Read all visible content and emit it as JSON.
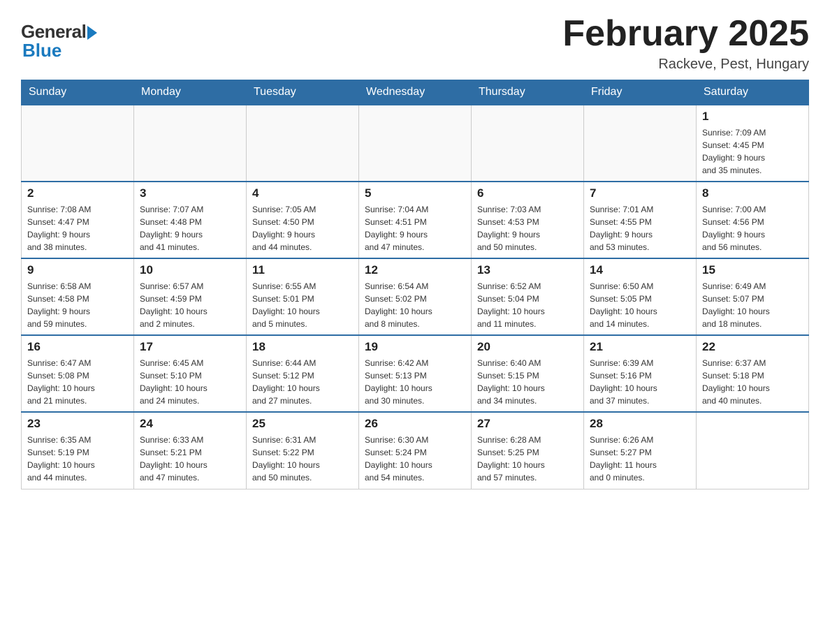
{
  "logo": {
    "general": "General",
    "blue": "Blue"
  },
  "header": {
    "month": "February 2025",
    "location": "Rackeve, Pest, Hungary"
  },
  "weekdays": [
    "Sunday",
    "Monday",
    "Tuesday",
    "Wednesday",
    "Thursday",
    "Friday",
    "Saturday"
  ],
  "weeks": [
    [
      {
        "day": "",
        "info": ""
      },
      {
        "day": "",
        "info": ""
      },
      {
        "day": "",
        "info": ""
      },
      {
        "day": "",
        "info": ""
      },
      {
        "day": "",
        "info": ""
      },
      {
        "day": "",
        "info": ""
      },
      {
        "day": "1",
        "info": "Sunrise: 7:09 AM\nSunset: 4:45 PM\nDaylight: 9 hours\nand 35 minutes."
      }
    ],
    [
      {
        "day": "2",
        "info": "Sunrise: 7:08 AM\nSunset: 4:47 PM\nDaylight: 9 hours\nand 38 minutes."
      },
      {
        "day": "3",
        "info": "Sunrise: 7:07 AM\nSunset: 4:48 PM\nDaylight: 9 hours\nand 41 minutes."
      },
      {
        "day": "4",
        "info": "Sunrise: 7:05 AM\nSunset: 4:50 PM\nDaylight: 9 hours\nand 44 minutes."
      },
      {
        "day": "5",
        "info": "Sunrise: 7:04 AM\nSunset: 4:51 PM\nDaylight: 9 hours\nand 47 minutes."
      },
      {
        "day": "6",
        "info": "Sunrise: 7:03 AM\nSunset: 4:53 PM\nDaylight: 9 hours\nand 50 minutes."
      },
      {
        "day": "7",
        "info": "Sunrise: 7:01 AM\nSunset: 4:55 PM\nDaylight: 9 hours\nand 53 minutes."
      },
      {
        "day": "8",
        "info": "Sunrise: 7:00 AM\nSunset: 4:56 PM\nDaylight: 9 hours\nand 56 minutes."
      }
    ],
    [
      {
        "day": "9",
        "info": "Sunrise: 6:58 AM\nSunset: 4:58 PM\nDaylight: 9 hours\nand 59 minutes."
      },
      {
        "day": "10",
        "info": "Sunrise: 6:57 AM\nSunset: 4:59 PM\nDaylight: 10 hours\nand 2 minutes."
      },
      {
        "day": "11",
        "info": "Sunrise: 6:55 AM\nSunset: 5:01 PM\nDaylight: 10 hours\nand 5 minutes."
      },
      {
        "day": "12",
        "info": "Sunrise: 6:54 AM\nSunset: 5:02 PM\nDaylight: 10 hours\nand 8 minutes."
      },
      {
        "day": "13",
        "info": "Sunrise: 6:52 AM\nSunset: 5:04 PM\nDaylight: 10 hours\nand 11 minutes."
      },
      {
        "day": "14",
        "info": "Sunrise: 6:50 AM\nSunset: 5:05 PM\nDaylight: 10 hours\nand 14 minutes."
      },
      {
        "day": "15",
        "info": "Sunrise: 6:49 AM\nSunset: 5:07 PM\nDaylight: 10 hours\nand 18 minutes."
      }
    ],
    [
      {
        "day": "16",
        "info": "Sunrise: 6:47 AM\nSunset: 5:08 PM\nDaylight: 10 hours\nand 21 minutes."
      },
      {
        "day": "17",
        "info": "Sunrise: 6:45 AM\nSunset: 5:10 PM\nDaylight: 10 hours\nand 24 minutes."
      },
      {
        "day": "18",
        "info": "Sunrise: 6:44 AM\nSunset: 5:12 PM\nDaylight: 10 hours\nand 27 minutes."
      },
      {
        "day": "19",
        "info": "Sunrise: 6:42 AM\nSunset: 5:13 PM\nDaylight: 10 hours\nand 30 minutes."
      },
      {
        "day": "20",
        "info": "Sunrise: 6:40 AM\nSunset: 5:15 PM\nDaylight: 10 hours\nand 34 minutes."
      },
      {
        "day": "21",
        "info": "Sunrise: 6:39 AM\nSunset: 5:16 PM\nDaylight: 10 hours\nand 37 minutes."
      },
      {
        "day": "22",
        "info": "Sunrise: 6:37 AM\nSunset: 5:18 PM\nDaylight: 10 hours\nand 40 minutes."
      }
    ],
    [
      {
        "day": "23",
        "info": "Sunrise: 6:35 AM\nSunset: 5:19 PM\nDaylight: 10 hours\nand 44 minutes."
      },
      {
        "day": "24",
        "info": "Sunrise: 6:33 AM\nSunset: 5:21 PM\nDaylight: 10 hours\nand 47 minutes."
      },
      {
        "day": "25",
        "info": "Sunrise: 6:31 AM\nSunset: 5:22 PM\nDaylight: 10 hours\nand 50 minutes."
      },
      {
        "day": "26",
        "info": "Sunrise: 6:30 AM\nSunset: 5:24 PM\nDaylight: 10 hours\nand 54 minutes."
      },
      {
        "day": "27",
        "info": "Sunrise: 6:28 AM\nSunset: 5:25 PM\nDaylight: 10 hours\nand 57 minutes."
      },
      {
        "day": "28",
        "info": "Sunrise: 6:26 AM\nSunset: 5:27 PM\nDaylight: 11 hours\nand 0 minutes."
      },
      {
        "day": "",
        "info": ""
      }
    ]
  ]
}
